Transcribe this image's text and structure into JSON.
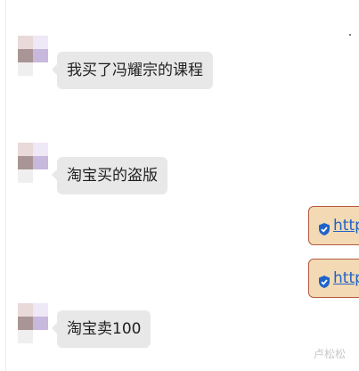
{
  "messages": [
    {
      "text": "我买了冯耀宗的课程"
    },
    {
      "text": "淘宝买的盗版"
    },
    {
      "link_text": "http"
    },
    {
      "link_text": "http"
    },
    {
      "text": "淘宝卖100"
    }
  ],
  "watermark": "卢松松",
  "colors": {
    "bubble": "#e8e8e8",
    "link_bubble": "#f3d9b4",
    "link_border": "#b45a3c",
    "link_text": "#1e63c8",
    "shield": "#1e63c8"
  },
  "icons": {
    "shield": "shield-check-icon",
    "avatar": "pixelated-avatar"
  }
}
